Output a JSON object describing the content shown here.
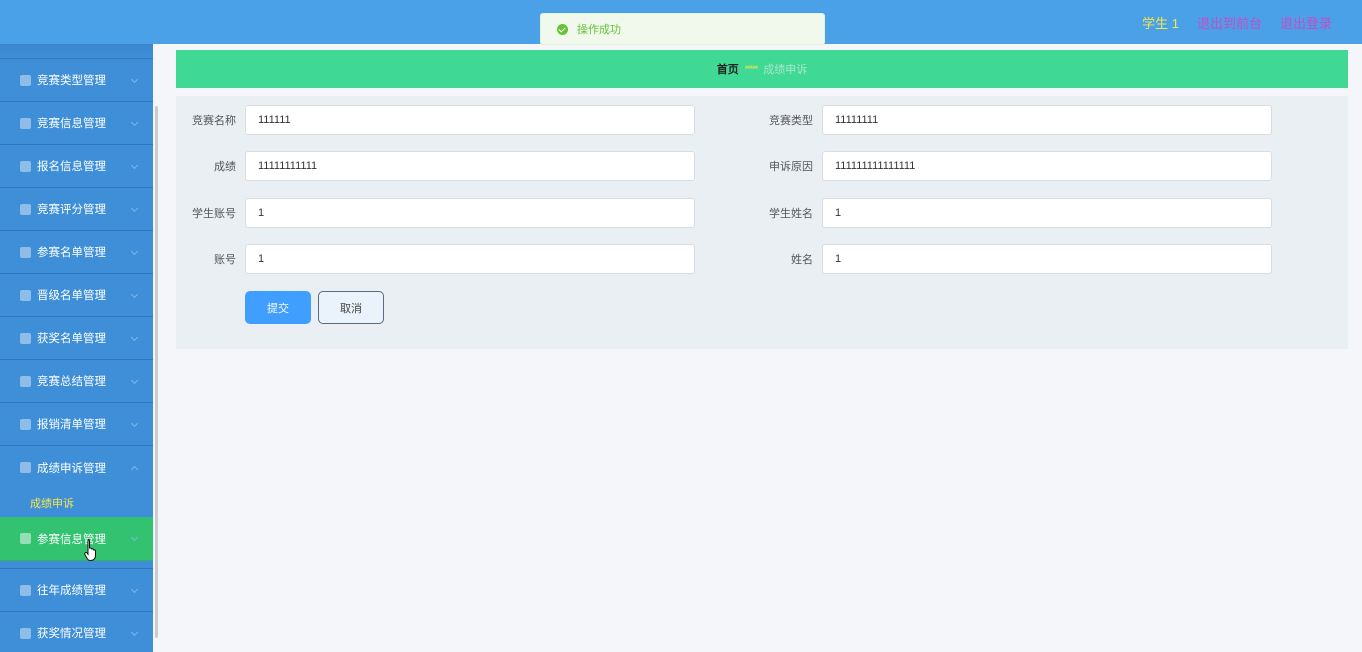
{
  "header": {
    "user": "学生 1",
    "front_link": "退出到前台",
    "logout_link": "退出登录"
  },
  "toast": {
    "message": "操作成功"
  },
  "sidebar": {
    "items": [
      {
        "label": "竞赛类型管理",
        "icon": "list-icon"
      },
      {
        "label": "竞赛信息管理",
        "icon": "calendar-icon"
      },
      {
        "label": "报名信息管理",
        "icon": "sliders-icon"
      },
      {
        "label": "竞赛评分管理",
        "icon": "compass-icon"
      },
      {
        "label": "参赛名单管理",
        "icon": "briefcase-icon"
      },
      {
        "label": "晋级名单管理",
        "icon": "bar-chart-icon"
      },
      {
        "label": "获奖名单管理",
        "icon": "card-icon"
      },
      {
        "label": "竞赛总结管理",
        "icon": "power-icon"
      },
      {
        "label": "报销清单管理",
        "icon": "grid-icon"
      },
      {
        "label": "成绩申诉管理",
        "icon": "balloon-icon"
      }
    ],
    "submenu_label": "成绩申诉",
    "active_item": {
      "label": "参赛信息管理",
      "icon": "check-square-icon"
    },
    "after_items": [
      {
        "label": "往年成绩管理",
        "icon": "crop-icon"
      },
      {
        "label": "获奖情况管理",
        "icon": "flag-icon"
      }
    ]
  },
  "breadcrumb": {
    "home": "首页",
    "separator": "*****",
    "current": "成绩申诉"
  },
  "form": {
    "fields": [
      {
        "label": "竞赛名称",
        "value": "111111"
      },
      {
        "label": "竞赛类型",
        "value": "11111111"
      },
      {
        "label": "成绩",
        "value": "11111111111"
      },
      {
        "label": "申诉原因",
        "value": "111111111111111"
      },
      {
        "label": "学生账号",
        "value": "1"
      },
      {
        "label": "学生姓名",
        "value": "1"
      },
      {
        "label": "账号",
        "value": "1"
      },
      {
        "label": "姓名",
        "value": "1"
      }
    ],
    "submit_label": "提交",
    "cancel_label": "取消"
  },
  "colors": {
    "topbar": "#4aa1e8",
    "sidebar": "#3e8fd8",
    "active_menu": "#32c270",
    "breadcrumb_bar": "#3fd995",
    "primary_button": "#409eff",
    "user_name": "#f5e64a",
    "top_links": "#c44cc9"
  }
}
